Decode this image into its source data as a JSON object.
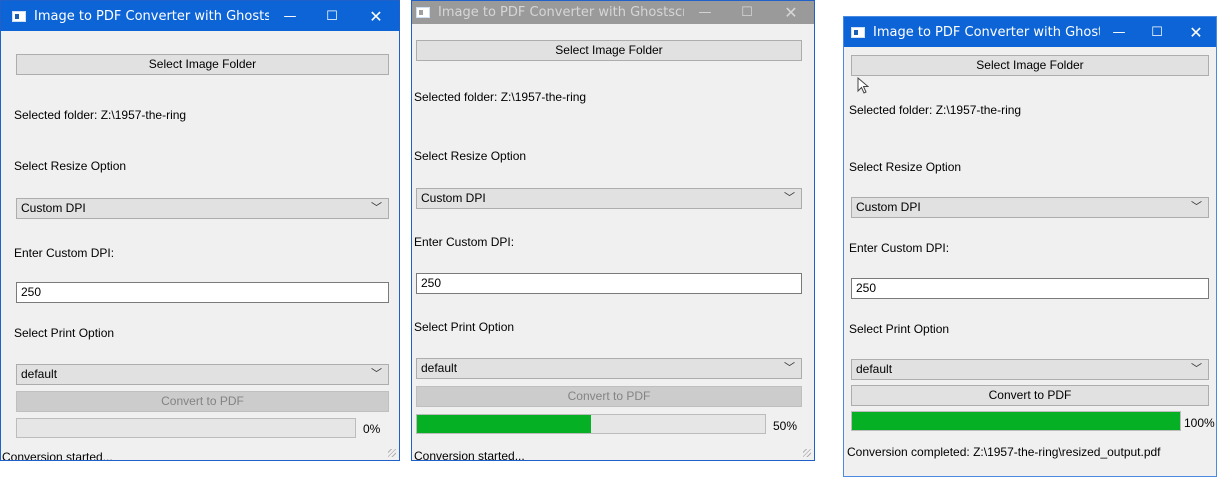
{
  "panels": [
    {
      "title": "Image to PDF Converter with Ghostscript",
      "select_folder_label": "Select Image Folder",
      "selected_folder_text": "Selected folder: Z:\\1957-the-ring",
      "resize_label": "Select Resize Option",
      "resize_value": "Custom DPI",
      "dpi_label": "Enter Custom DPI:",
      "dpi_value": "250",
      "print_label": "Select Print Option",
      "print_value": "default",
      "convert_label": "Convert to PDF",
      "progress_percent": 0,
      "progress_text": "0%",
      "status_text": "Conversion started..."
    },
    {
      "title": "Image to PDF Converter with Ghostscript",
      "select_folder_label": "Select Image Folder",
      "selected_folder_text": "Selected folder: Z:\\1957-the-ring",
      "resize_label": "Select Resize Option",
      "resize_value": "Custom DPI",
      "dpi_label": "Enter Custom DPI:",
      "dpi_value": "250",
      "print_label": "Select Print Option",
      "print_value": "default",
      "convert_label": "Convert to PDF",
      "progress_percent": 50,
      "progress_text": "50%",
      "status_text": "Conversion started..."
    },
    {
      "title": "Image to PDF Converter with Ghostscript",
      "select_folder_label": "Select Image Folder",
      "selected_folder_text": "Selected folder: Z:\\1957-the-ring",
      "resize_label": "Select Resize Option",
      "resize_value": "Custom DPI",
      "dpi_label": "Enter Custom DPI:",
      "dpi_value": "250",
      "print_label": "Select Print Option",
      "print_value": "default",
      "convert_label": "Convert to PDF",
      "progress_percent": 100,
      "progress_text": "100%",
      "status_text": "Conversion completed: Z:\\1957-the-ring\\resized_output.pdf"
    }
  ],
  "window_controls": {
    "minimize": "—",
    "maximize": "☐",
    "close": "✕"
  },
  "icons": {
    "combo_arrow": "chevron-down-icon",
    "cursor": "mouse-pointer-icon",
    "app": "app-window-icon"
  },
  "colors": {
    "titlebar_active": "#0d64d6",
    "titlebar_inactive": "#9a9a9a",
    "progress_fill": "#06b025"
  }
}
